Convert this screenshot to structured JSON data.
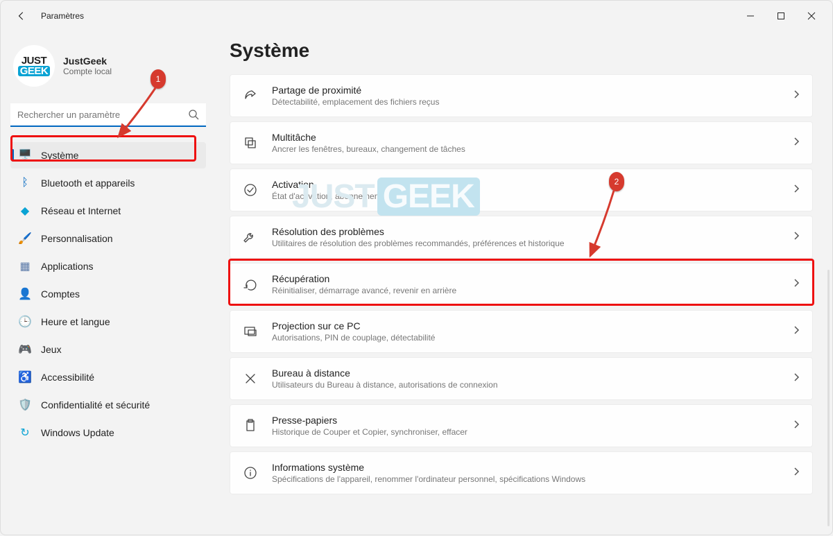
{
  "titlebar": {
    "title": "Paramètres"
  },
  "profile": {
    "logo_l1": "JUST",
    "logo_l2": "GEEK",
    "name": "JustGeek",
    "sub": "Compte local"
  },
  "search": {
    "placeholder": "Rechercher un paramètre"
  },
  "sidebar": {
    "items": [
      {
        "id": "systeme",
        "label": "Système",
        "icon": "🖥️",
        "active": true
      },
      {
        "id": "bluetooth",
        "label": "Bluetooth et appareils",
        "icon": "ᛒ",
        "iconColor": "#0067c0"
      },
      {
        "id": "reseau",
        "label": "Réseau et Internet",
        "icon": "◆",
        "iconColor": "#0aa3d4"
      },
      {
        "id": "personnalisation",
        "label": "Personnalisation",
        "icon": "🖌️"
      },
      {
        "id": "applications",
        "label": "Applications",
        "icon": "▦",
        "iconColor": "#5b7aa8"
      },
      {
        "id": "comptes",
        "label": "Comptes",
        "icon": "👤",
        "iconColor": "#3aa06f"
      },
      {
        "id": "heure",
        "label": "Heure et langue",
        "icon": "🕒",
        "iconColor": "#c07a2e"
      },
      {
        "id": "jeux",
        "label": "Jeux",
        "icon": "🎮"
      },
      {
        "id": "accessibilite",
        "label": "Accessibilité",
        "icon": "♿",
        "iconColor": "#5b7aa8"
      },
      {
        "id": "confidentialite",
        "label": "Confidentialité et sécurité",
        "icon": "🛡️",
        "iconColor": "#888"
      },
      {
        "id": "update",
        "label": "Windows Update",
        "icon": "↻",
        "iconColor": "#0aa3d4"
      }
    ]
  },
  "page": {
    "title": "Système"
  },
  "cards": [
    {
      "id": "partage",
      "title": "Partage de proximité",
      "sub": "Détectabilité, emplacement des fichiers reçus",
      "icon": "share"
    },
    {
      "id": "multitache",
      "title": "Multitâche",
      "sub": "Ancrer les fenêtres, bureaux, changement de tâches",
      "icon": "copy"
    },
    {
      "id": "activation",
      "title": "Activation",
      "sub": "État d'activation, abonnements, clé de produit",
      "icon": "check"
    },
    {
      "id": "resolution",
      "title": "Résolution des problèmes",
      "sub": "Utilitaires de résolution des problèmes recommandés, préférences et historique",
      "icon": "wrench"
    },
    {
      "id": "recuperation",
      "title": "Récupération",
      "sub": "Réinitialiser, démarrage avancé, revenir en arrière",
      "icon": "recovery"
    },
    {
      "id": "projection",
      "title": "Projection sur ce PC",
      "sub": "Autorisations, PIN de couplage, détectabilité",
      "icon": "projection"
    },
    {
      "id": "bureau",
      "title": "Bureau à distance",
      "sub": "Utilisateurs du Bureau à distance, autorisations de connexion",
      "icon": "remote"
    },
    {
      "id": "presse",
      "title": "Presse-papiers",
      "sub": "Historique de Couper et Copier, synchroniser, effacer",
      "icon": "clipboard"
    },
    {
      "id": "infos",
      "title": "Informations système",
      "sub": "Spécifications de l'appareil, renommer l'ordinateur personnel, spécifications Windows",
      "icon": "info"
    }
  ],
  "annotations": {
    "badge1": "1",
    "badge2": "2"
  },
  "watermark": {
    "l1": "JUST",
    "l2": "GEEK"
  }
}
